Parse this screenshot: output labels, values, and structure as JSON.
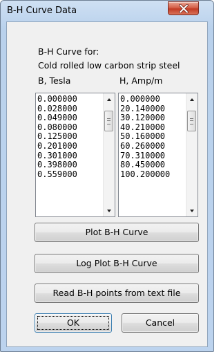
{
  "window": {
    "title": "B-H Curve Data"
  },
  "heading": {
    "line1": "B-H Curve for:",
    "line2": "Cold rolled low carbon strip steel"
  },
  "columns": {
    "b_label": "B, Tesla",
    "h_label": "H, Amp/m"
  },
  "b_values": [
    "0.000000",
    "0.028000",
    "0.049000",
    "0.080000",
    "0.125000",
    "0.201000",
    "0.301000",
    "0.398000",
    "0.559000"
  ],
  "h_values": [
    "0.000000",
    "20.140000",
    "30.120000",
    "40.210000",
    "50.160000",
    "60.260000",
    "70.310000",
    "80.450000",
    "100.200000"
  ],
  "buttons": {
    "plot": "Plot B-H Curve",
    "log_plot": "Log Plot B-H Curve",
    "read": "Read B-H points from text file",
    "ok": "OK",
    "cancel": "Cancel"
  },
  "icons": {
    "close": "close-icon",
    "scroll_up": "arrow-up-icon",
    "scroll_down": "arrow-down-icon"
  }
}
